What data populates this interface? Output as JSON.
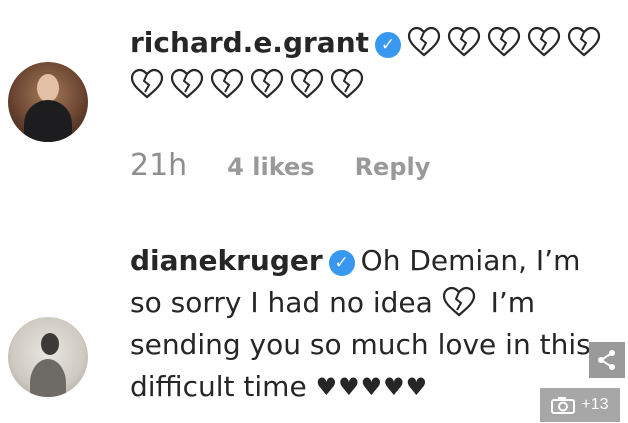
{
  "comments": [
    {
      "username": "richard.e.grant",
      "verified": true,
      "broken_heart_count_line1": 5,
      "broken_heart_count_line2": 6,
      "time": "21h",
      "likes": "4 likes",
      "reply": "Reply"
    },
    {
      "username": "dianekruger",
      "verified": true,
      "text_part1": "Oh Demian, I’m so sorry I had no idea",
      "text_part2": "I’m sending you so much love in this difficult time",
      "black_hearts": "♥♥♥♥♥"
    }
  ],
  "overlay": {
    "gallery_count": "+13"
  },
  "icons": {
    "verified": "verified-badge-icon",
    "broken_heart": "broken-heart-icon",
    "share": "share-icon",
    "camera": "camera-icon"
  },
  "colors": {
    "verified_blue": "#3897f0",
    "meta_gray": "#8e8e8e"
  }
}
